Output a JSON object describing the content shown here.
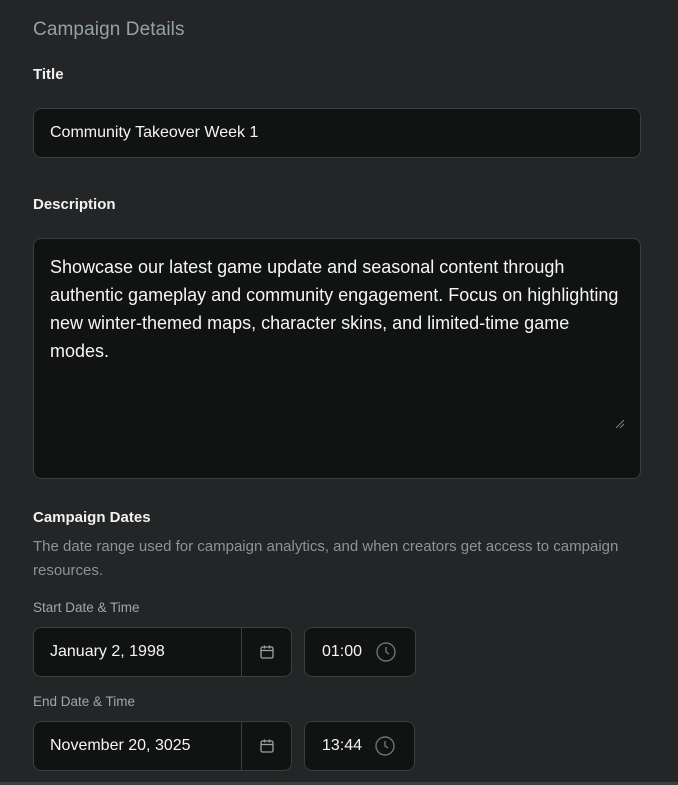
{
  "section": {
    "title": "Campaign Details"
  },
  "title_field": {
    "label": "Title",
    "value": "Community Takeover Week 1"
  },
  "description_field": {
    "label": "Description",
    "value": "Showcase our latest game update and seasonal content through authentic gameplay and community engagement. Focus on highlighting new winter-themed maps, character skins, and limited-time game modes."
  },
  "campaign_dates": {
    "label": "Campaign Dates",
    "help": "The date range used for campaign analytics, and when creators get access to campaign resources.",
    "start": {
      "label": "Start Date & Time",
      "date": "January 2, 1998",
      "time": "01:00",
      "calendar_icon": "calendar-icon",
      "clock_icon": "clock-icon"
    },
    "end": {
      "label": "End Date & Time",
      "date": "November 20, 3025",
      "time": "13:44",
      "calendar_icon": "calendar-icon",
      "clock_icon": "clock-icon"
    }
  },
  "colors": {
    "background": "#232526",
    "field_background": "#111212",
    "field_border": "#3b3d3e",
    "section_title": "#95a3a0",
    "muted_text": "#8f9394"
  }
}
